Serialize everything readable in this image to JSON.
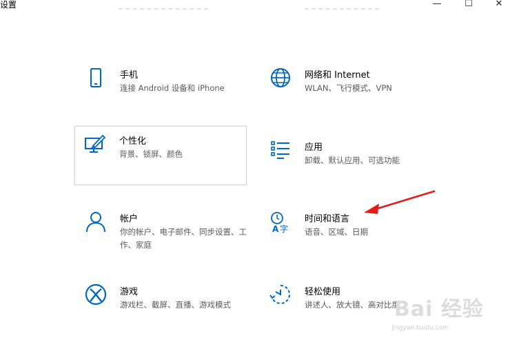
{
  "window": {
    "title": "设置",
    "minimize_glyph": "—",
    "maximize_glyph": "☐",
    "close_glyph": "✕"
  },
  "accent_color": "#0067c0",
  "annotation_arrow_color": "#e41b17",
  "tiles": [
    {
      "name": "手机",
      "desc": "连接 Android 设备和 iPhone",
      "icon": "phone-icon"
    },
    {
      "name": "网络和 Internet",
      "desc": "WLAN、飞行模式、VPN",
      "icon": "globe-icon"
    },
    {
      "name": "个性化",
      "desc": "背景、锁屏、颜色",
      "icon": "personalization-icon"
    },
    {
      "name": "应用",
      "desc": "卸载、默认应用、可选功能",
      "icon": "apps-list-icon"
    },
    {
      "name": "帐户",
      "desc": "你的帐户、电子邮件、同步设置、工作、家庭",
      "icon": "person-icon"
    },
    {
      "name": "时间和语言",
      "desc": "语音、区域、日期",
      "icon": "time-language-icon"
    },
    {
      "name": "游戏",
      "desc": "游戏栏、截屏、直播、游戏模式",
      "icon": "xbox-icon"
    },
    {
      "name": "轻松使用",
      "desc": "讲述人、放大镜、高对比度",
      "icon": "ease-of-access-icon"
    }
  ],
  "watermark": {
    "main": "Bai 经验",
    "sub": "jingyan.baidu.com"
  }
}
